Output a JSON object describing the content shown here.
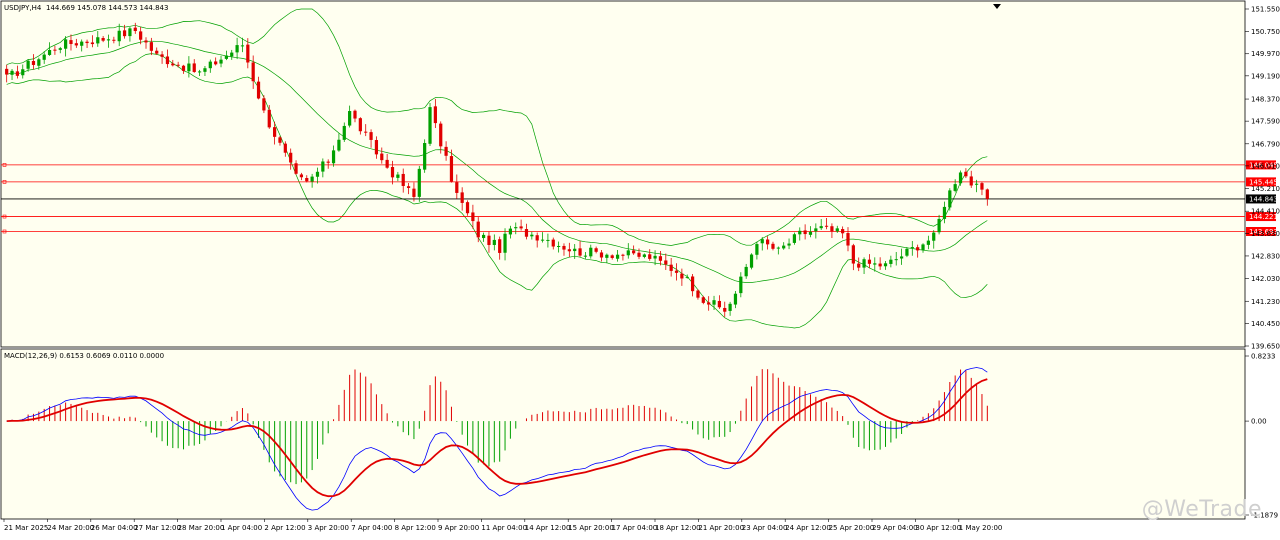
{
  "chart_data": [
    {
      "type": "candlestick",
      "symbol_label": "USDJPY,H4",
      "ohlc_label": "144.669 145.078 144.573 144.843",
      "last_price": 144.843,
      "ylim": [
        139.65,
        151.55
      ],
      "y_ticks": [
        151.55,
        150.75,
        149.97,
        149.19,
        148.37,
        147.59,
        146.79,
        146.01,
        145.21,
        144.41,
        143.63,
        142.83,
        142.03,
        141.23,
        140.45,
        139.65
      ],
      "y_tick_labels": [
        "151.550",
        "150.750",
        "149.970",
        "149.190",
        "148.370",
        "147.590",
        "146.790",
        "146.010",
        "145.210",
        "144.410",
        "143.630",
        "142.830",
        "142.030",
        "141.230",
        "140.450",
        "139.650"
      ],
      "horizontal_lines": [
        {
          "value": 146.045,
          "label": "146.045",
          "color": "#ff0000"
        },
        {
          "value": 145.445,
          "label": "145.445",
          "color": "#ff0000"
        },
        {
          "value": 144.221,
          "label": "144.221",
          "color": "#ff0000"
        },
        {
          "value": 143.693,
          "label": "143.693",
          "color": "#ff0000"
        },
        {
          "value": 144.843,
          "label": "144.843",
          "color": "#000000"
        }
      ],
      "x_ticks": [
        "21 Mar 2025",
        "24 Mar 20:00",
        "26 Mar 04:00",
        "27 Mar 12:00",
        "28 Mar 20:00",
        "1 Apr 04:00",
        "2 Apr 12:00",
        "3 Apr 20:00",
        "7 Apr 04:00",
        "8 Apr 12:00",
        "9 Apr 20:00",
        "11 Apr 04:00",
        "14 Apr 12:00",
        "15 Apr 20:00",
        "17 Apr 04:00",
        "18 Apr 12:00",
        "21 Apr 20:00",
        "23 Apr 04:00",
        "24 Apr 12:00",
        "25 Apr 20:00",
        "29 Apr 04:00",
        "30 Apr 12:00",
        "1 May 20:00"
      ],
      "path_anchors": [
        [
          0,
          149.1
        ],
        [
          10,
          150.3
        ],
        [
          18,
          150.5
        ],
        [
          24,
          150.8
        ],
        [
          28,
          149.9
        ],
        [
          36,
          149.3
        ],
        [
          44,
          150.3
        ],
        [
          48,
          147.9
        ],
        [
          54,
          145.6
        ],
        [
          56,
          145.4
        ],
        [
          60,
          146.2
        ],
        [
          64,
          147.9
        ],
        [
          70,
          146.2
        ],
        [
          76,
          144.9
        ],
        [
          79,
          148.0
        ],
        [
          84,
          145.0
        ],
        [
          88,
          143.6
        ],
        [
          92,
          143.1
        ],
        [
          94,
          143.8
        ],
        [
          100,
          143.5
        ],
        [
          106,
          143.0
        ],
        [
          114,
          142.9
        ],
        [
          120,
          142.8
        ],
        [
          126,
          142.2
        ],
        [
          130,
          141.3
        ],
        [
          134,
          140.9
        ],
        [
          136,
          141.5
        ],
        [
          140,
          143.4
        ],
        [
          144,
          143.0
        ],
        [
          148,
          143.6
        ],
        [
          152,
          143.8
        ],
        [
          156,
          143.6
        ],
        [
          158,
          142.6
        ],
        [
          164,
          142.5
        ],
        [
          170,
          143.2
        ],
        [
          173,
          143.5
        ],
        [
          175,
          144.7
        ],
        [
          178,
          145.9
        ],
        [
          180,
          145.4
        ],
        [
          183,
          144.843
        ]
      ],
      "bollinger": {
        "period": 20,
        "deviation": 2,
        "color": "#00a000"
      },
      "bull_color": "#00a000",
      "bear_color": "#e00000",
      "background": "#fffff0"
    },
    {
      "type": "macd",
      "label": "MACD(12,26,9) 0.6153 0.6069 0.0110 0.0000",
      "ylim": [
        -1.1879,
        0.8233
      ],
      "y_tick_labels": [
        "0.8233",
        "0.00",
        "-1.1879"
      ],
      "histogram_colors": {
        "positive": "#e00000",
        "negative": "#00a000"
      },
      "macd_line_color": "#0000ff",
      "signal_line_color": "#e00000"
    }
  ],
  "watermark": "@WeTrade"
}
